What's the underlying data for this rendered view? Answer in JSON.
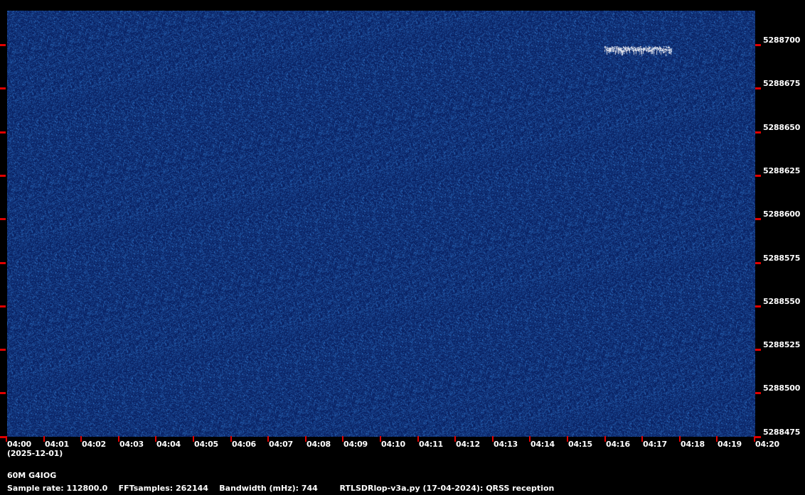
{
  "waterfall": {
    "frequency_labels": [
      "5288700",
      "5288675",
      "5288650",
      "5288625",
      "5288600",
      "5288575",
      "5288550",
      "5288525",
      "5288500",
      "5288475"
    ],
    "time_labels": [
      "04:00",
      "04:01",
      "04:02",
      "04:03",
      "04:04",
      "04:05",
      "04:06",
      "04:07",
      "04:08",
      "04:09",
      "04:10",
      "04:11",
      "04:12",
      "04:13",
      "04:14",
      "04:15",
      "04:16",
      "04:17",
      "04:18",
      "04:19",
      "04:20"
    ],
    "date": "(2025-12-01)",
    "signal": {
      "freq_hz": 5288695,
      "start_time": "04:15.9",
      "end_time": "04:17.8"
    },
    "colors": {
      "background": "#000000",
      "noise": "#0c2c70",
      "signal": "#d8dce8",
      "tick": "#e00000"
    }
  },
  "footer": {
    "station": "60M G4IOG",
    "sample_rate": "Sample rate: 112800.0",
    "fft_samples": "FFTsamples: 262144",
    "bandwidth": "Bandwidth (mHz): 744",
    "program": "RTLSDRlop-v3a.py (17-04-2024): QRSS reception"
  }
}
